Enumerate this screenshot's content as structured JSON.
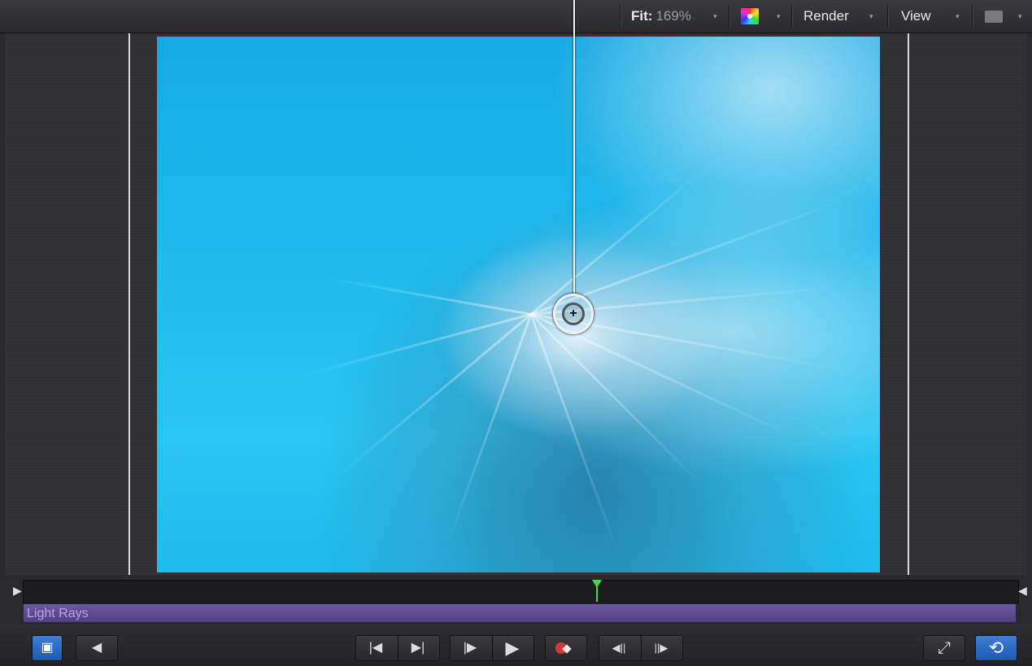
{
  "toolbar": {
    "fit_label": "Fit:",
    "fit_value": "169%",
    "render_label": "Render",
    "view_label": "View",
    "dropdown_arrow": "▾"
  },
  "timeline": {
    "clip_name": "Light Rays",
    "in_marker": "◀",
    "out_marker": "▶"
  },
  "transport": {
    "toggle_glyph": "▣",
    "audio_glyph": "◀",
    "go_to_start": "|◀",
    "go_to_end": "▶|",
    "play_from_start": "|▶",
    "play": "▶",
    "prev_frame": "◀||",
    "next_frame": "||▶",
    "fullscreen": "⤢",
    "loop": "⟲"
  },
  "icons": {
    "color-channels-icon": "rainbow swatch",
    "layout-icon": "gray rectangle",
    "record-icon": "red dot with diamond"
  },
  "colors": {
    "accent_blue": "#1c58b0",
    "playhead_green": "#4cd24c",
    "clip_purple": "#51407f",
    "record_red": "#d23a3a"
  }
}
